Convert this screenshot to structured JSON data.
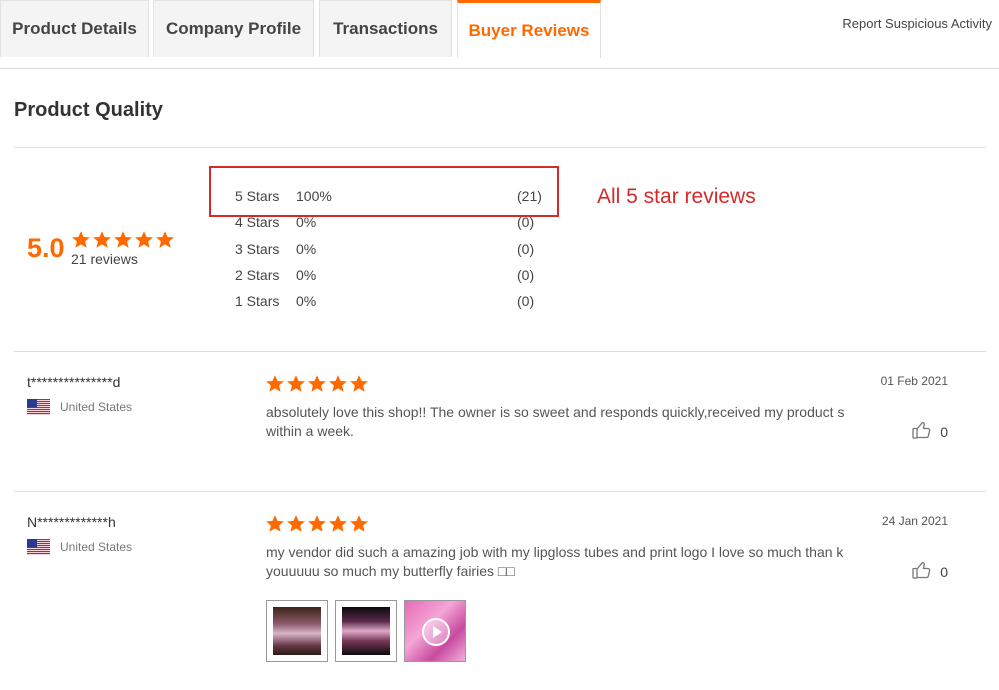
{
  "tabs": [
    {
      "label": "Product Details",
      "active": false
    },
    {
      "label": "Company Profile",
      "active": false
    },
    {
      "label": "Transactions",
      "active": false
    },
    {
      "label": "Buyer Reviews",
      "active": true
    }
  ],
  "report_link": "Report Suspicious Activity",
  "section_title": "Product Quality",
  "summary": {
    "score": "5.0",
    "rating": 5,
    "review_count_label": "21 reviews"
  },
  "breakdown": [
    {
      "label": "5 Stars",
      "percent": "100%",
      "count": "(21)"
    },
    {
      "label": "4 Stars",
      "percent": "0%",
      "count": "(0)"
    },
    {
      "label": "3 Stars",
      "percent": "0%",
      "count": "(0)"
    },
    {
      "label": "2 Stars",
      "percent": "0%",
      "count": "(0)"
    },
    {
      "label": "1 Stars",
      "percent": "0%",
      "count": "(0)"
    }
  ],
  "annotation": "All 5 star reviews",
  "reviews": [
    {
      "name": "t***************d",
      "country": "United States",
      "rating": 5,
      "date": "01 Feb 2021",
      "text": "absolutely love this shop!! The owner is so sweet and responds quickly,received my product s within a week.",
      "likes": "0"
    },
    {
      "name": "N*************h",
      "country": "United States",
      "rating": 5,
      "date": "24 Jan 2021",
      "text": "my vendor did such a amazing job with my lipgloss tubes and print logo I love so much than k youuuuu so much my butterfly fairies □□",
      "likes": "0",
      "photos": [
        "photo",
        "photo",
        "video"
      ]
    }
  ],
  "colors": {
    "accent": "#ff6a00",
    "annotation": "#d42a2a"
  }
}
